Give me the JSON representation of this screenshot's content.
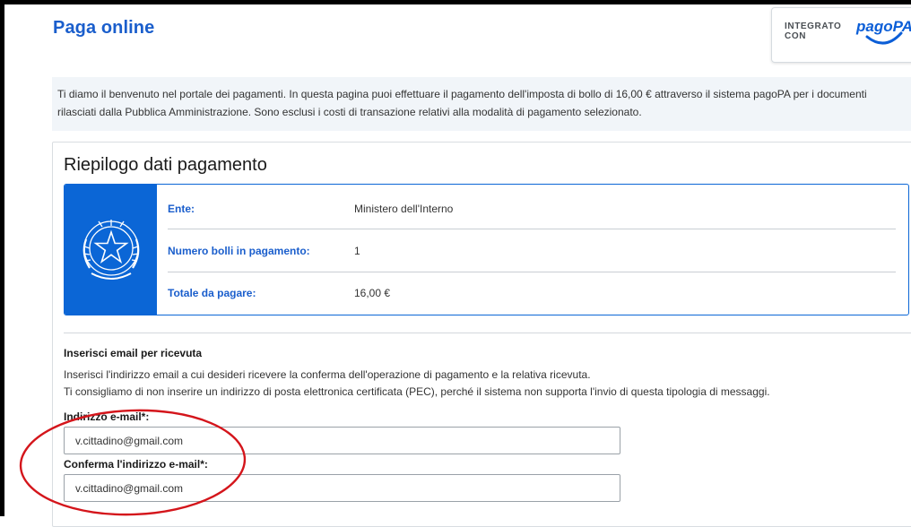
{
  "header": {
    "title": "Paga online",
    "integrated_with_label": "INTEGRATO CON",
    "pagopa_logo": "pagoPA"
  },
  "intro": {
    "text": "Ti diamo il benvenuto nel portale dei pagamenti. In questa pagina puoi effettuare il pagamento dell'imposta di bollo di 16,00 € attraverso il sistema pagoPA per i documenti rilasciati dalla Pubblica Amministrazione. Sono esclusi i costi di transazione relativi alla modalità di pagamento selezionato."
  },
  "summary": {
    "title": "Riepilogo dati pagamento",
    "emblem_icon": "italian-republic-emblem-icon",
    "rows": [
      {
        "label": "Ente:",
        "value": "Ministero dell'Interno"
      },
      {
        "label": "Numero bolli in pagamento:",
        "value": "1"
      },
      {
        "label": "Totale da pagare:",
        "value": "16,00 €"
      }
    ]
  },
  "email": {
    "heading": "Inserisci email per ricevuta",
    "desc_line1": "Inserisci l'indirizzo email a cui desideri ricevere la conferma dell'operazione di pagamento e la relativa ricevuta.",
    "desc_line2": "Ti consigliamo di non inserire un indirizzo di posta elettronica certificata (PEC), perché il sistema non supporta l'invio di questa tipologia di messaggi.",
    "email_label": "Indirizzo e-mail*:",
    "email_value": "v.cittadino@gmail.com",
    "confirm_label": "Conferma l'indirizzo e-mail*:",
    "confirm_value": "v.cittadino@gmail.com"
  },
  "colors": {
    "accent": "#1a5ecc",
    "summary_blue": "#0b66d6",
    "highlight_red": "#d4151b",
    "intro_bg": "#f1f5f9"
  }
}
